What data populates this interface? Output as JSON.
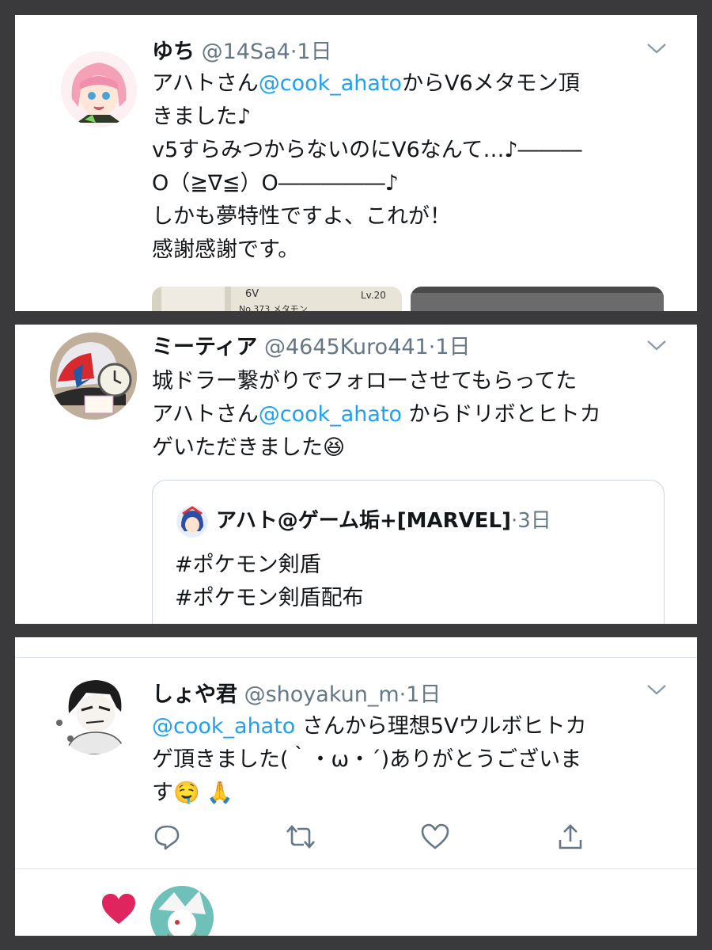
{
  "tweets": [
    {
      "name": "ゆち",
      "handle": "@14Sa4",
      "dot": "·",
      "time": "1日",
      "text_a": "アハトさん",
      "mention": "@cook_ahato",
      "text_b": "からV6メタモン頂\nきました♪\nv5すらみつからないのにV6なんて…♪―――\nO（≧∇≦）O―――――♪\nしかも夢特性ですよ、これが！\n感謝感謝です。",
      "media_text": {
        "badge": "6V",
        "level": "Lv.20",
        "line": "No.373 メタモン"
      }
    },
    {
      "name": "ミーティア",
      "handle": "@4645Kuro441",
      "dot": "·",
      "time": "1日",
      "text_a": "城ドラー繋がりでフォローさせてもらってた\nアハトさん",
      "mention": "@cook_ahato",
      "text_b": " からドリボとヒトカ\nゲいただきました😆",
      "quote": {
        "name": "アハト@ゲーム垢+[MARVEL]",
        "dot": "·",
        "time": "3日",
        "text": "#ポケモン剣盾\n#ポケモン剣盾配布"
      }
    },
    {
      "name": "しょや君",
      "handle": "@shoyakun_m",
      "dot": "·",
      "time": "1日",
      "mention": "@cook_ahato",
      "text_b": " さんから理想5Vウルボヒトカ\nゲ頂きました(｀・ω・´)ありがとうございま\nす🤤 🙏",
      "actions": [
        "reply-icon",
        "retweet-icon",
        "like-icon",
        "share-icon"
      ],
      "liked_by": "heart-icon"
    }
  ],
  "colors": {
    "accent": "#1da1f2",
    "secondary_text": "#657786",
    "like": "#e0245e",
    "border": "#3a3a3c"
  }
}
